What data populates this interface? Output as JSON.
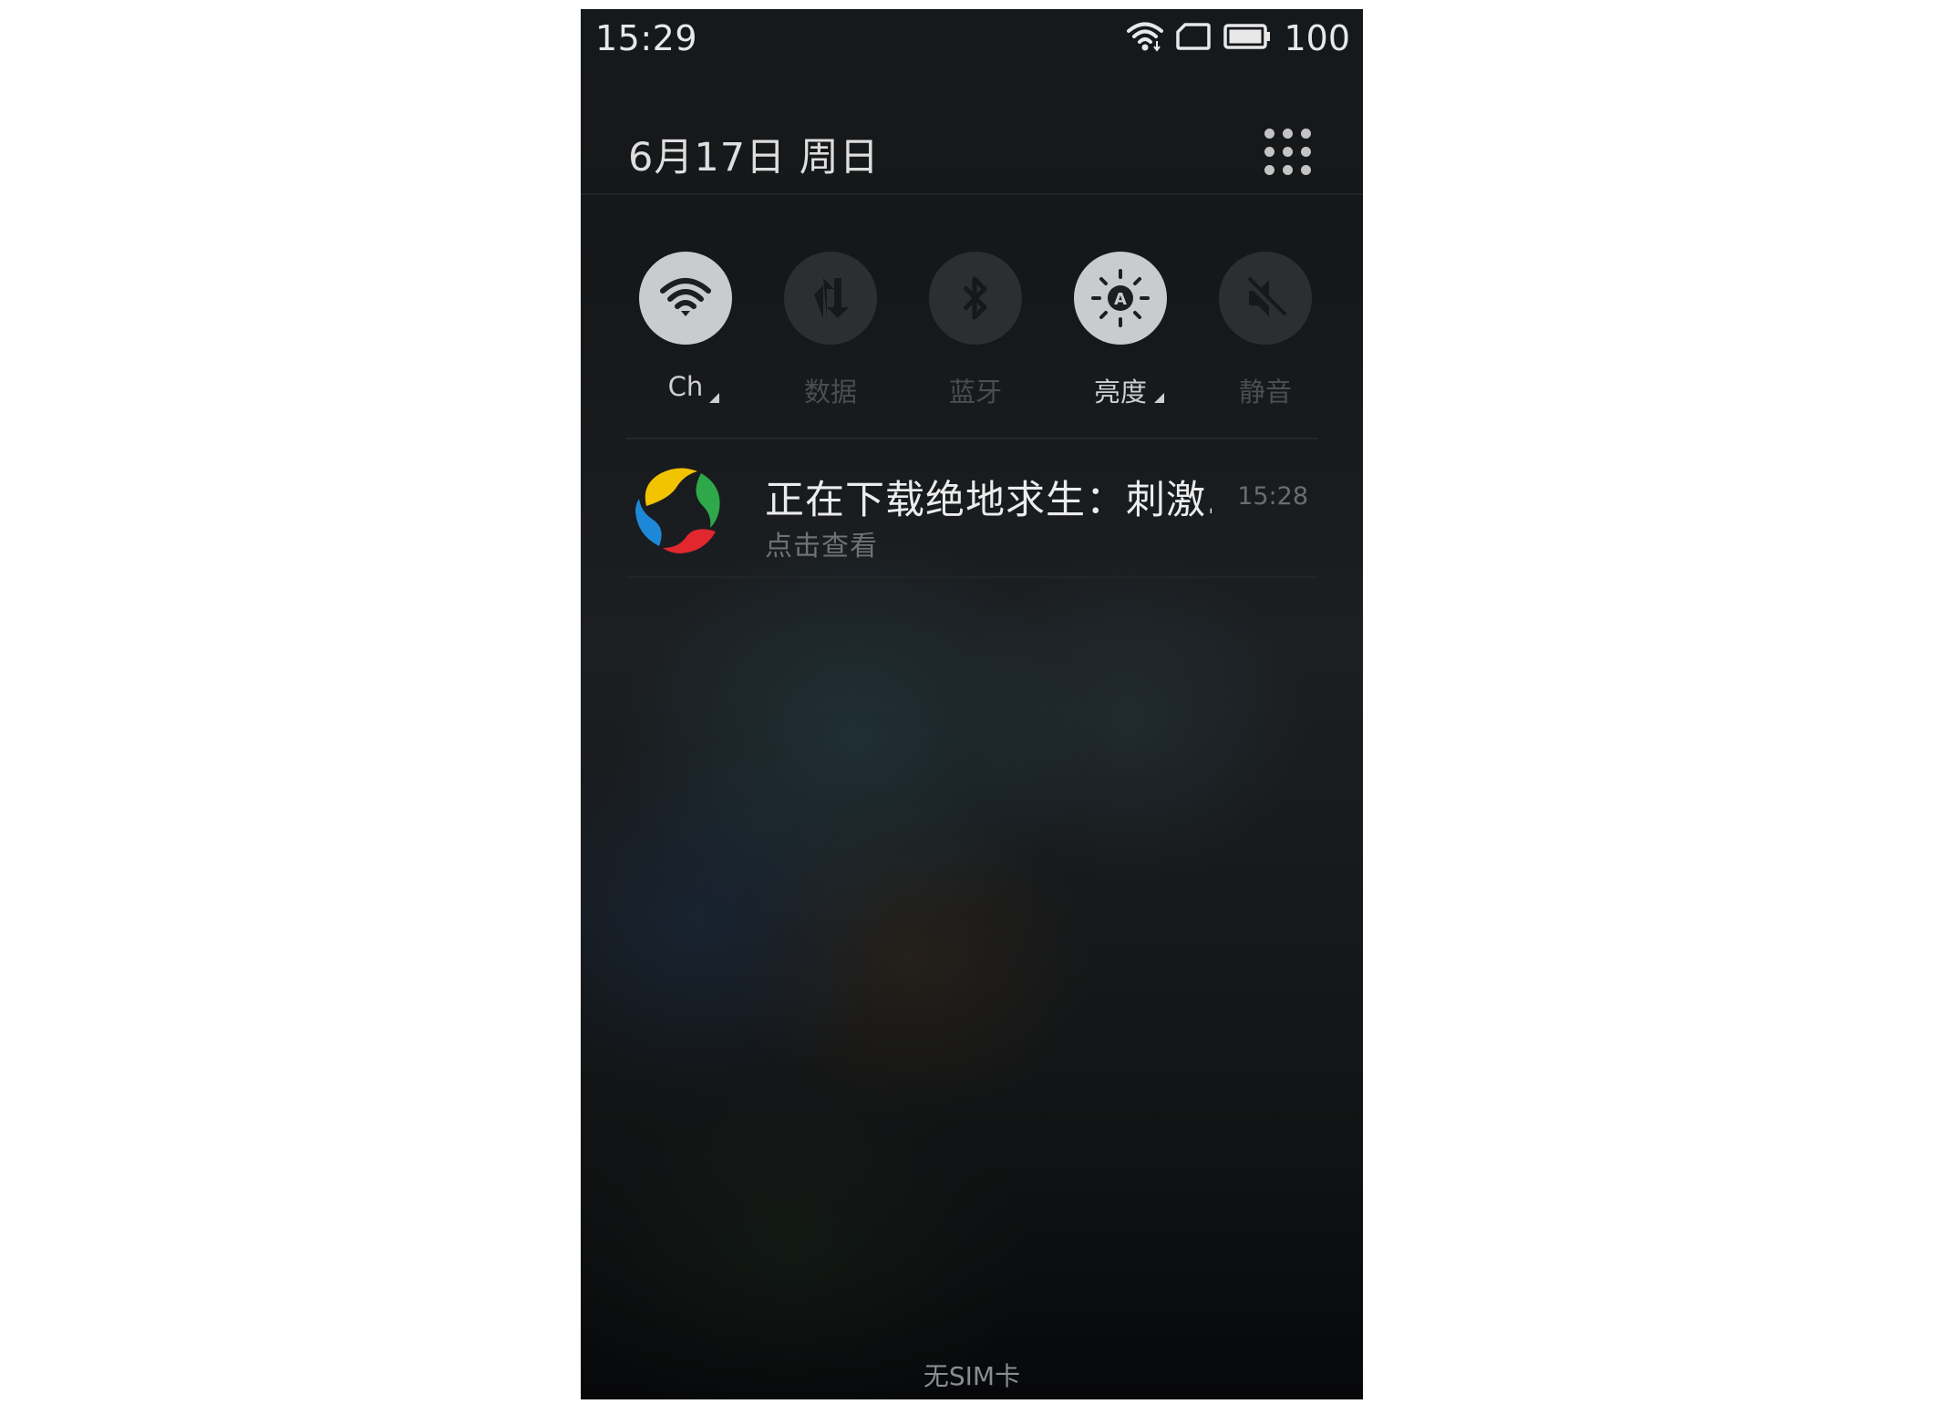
{
  "status_bar": {
    "time": "15:29",
    "battery_level": "100",
    "icons": [
      "wifi-icon",
      "sim-card-icon",
      "battery-icon"
    ]
  },
  "header": {
    "date": "6月17日  周日",
    "grid_icon": "app-grid-icon"
  },
  "quick_toggles": [
    {
      "label": "Ch",
      "icon": "wifi-icon",
      "active": true,
      "has_menu": true
    },
    {
      "label": "数据",
      "icon": "mobile-data-icon",
      "active": false,
      "has_menu": false
    },
    {
      "label": "蓝牙",
      "icon": "bluetooth-icon",
      "active": false,
      "has_menu": false
    },
    {
      "label": "亮度",
      "icon": "brightness-auto-icon",
      "active": true,
      "has_menu": true
    },
    {
      "label": "静音",
      "icon": "mute-icon",
      "active": false,
      "has_menu": false
    }
  ],
  "notification": {
    "app_icon": "app-store-logo-icon",
    "title": "正在下载绝地求生：刺激..",
    "subtitle": "点击查看",
    "time": "15:28"
  },
  "footer": {
    "sim_status": "无SIM卡"
  },
  "colors": {
    "toggle_active": "#c9cbcc",
    "toggle_inactive": "#2c2f32",
    "logo_yellow": "#f2c400",
    "logo_green": "#2ea84a",
    "logo_red": "#e0282e",
    "logo_blue": "#1e88d8"
  }
}
